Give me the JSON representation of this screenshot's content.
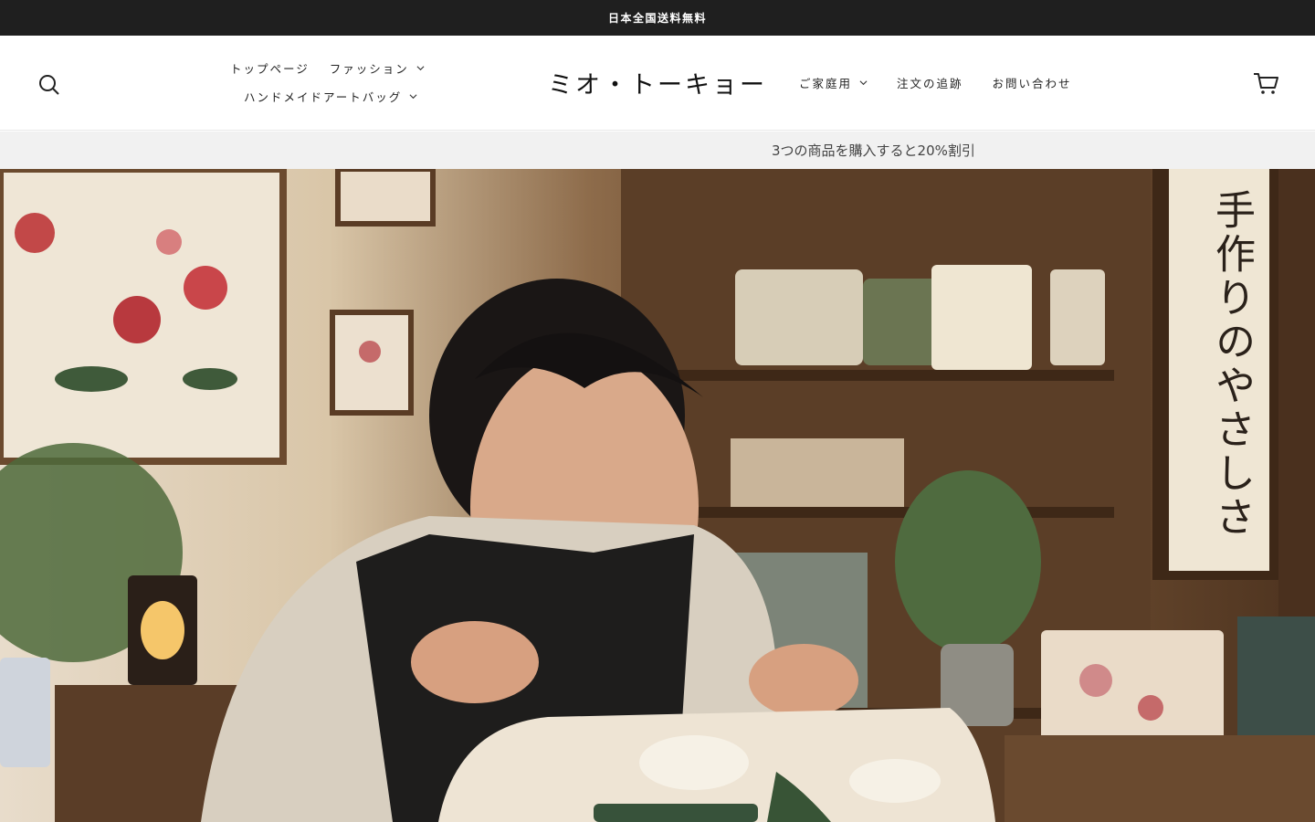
{
  "announcement": {
    "text": "日本全国送料無料"
  },
  "header": {
    "logo": "ミオ・トーキョー",
    "nav_left": [
      {
        "label": "トップページ",
        "has_dropdown": false
      },
      {
        "label": "ファッション",
        "has_dropdown": true
      },
      {
        "label": "ハンドメイドアートバッグ",
        "has_dropdown": true
      }
    ],
    "nav_right": [
      {
        "label": "ご家庭用",
        "has_dropdown": true
      },
      {
        "label": "注文の追跡",
        "has_dropdown": false
      },
      {
        "label": "お問い合わせ",
        "has_dropdown": false
      }
    ],
    "icons": {
      "search": "search-icon",
      "cart": "cart-icon"
    }
  },
  "promo": {
    "text": "3つの商品を購入すると20%割引"
  },
  "hero": {
    "banner_text": "手作りのやさしさ",
    "colors": {
      "wall": "#e8dccb",
      "shelf": "#5b3e27",
      "apron": "#1e1d1c",
      "quilt": "#eee4d4"
    }
  }
}
